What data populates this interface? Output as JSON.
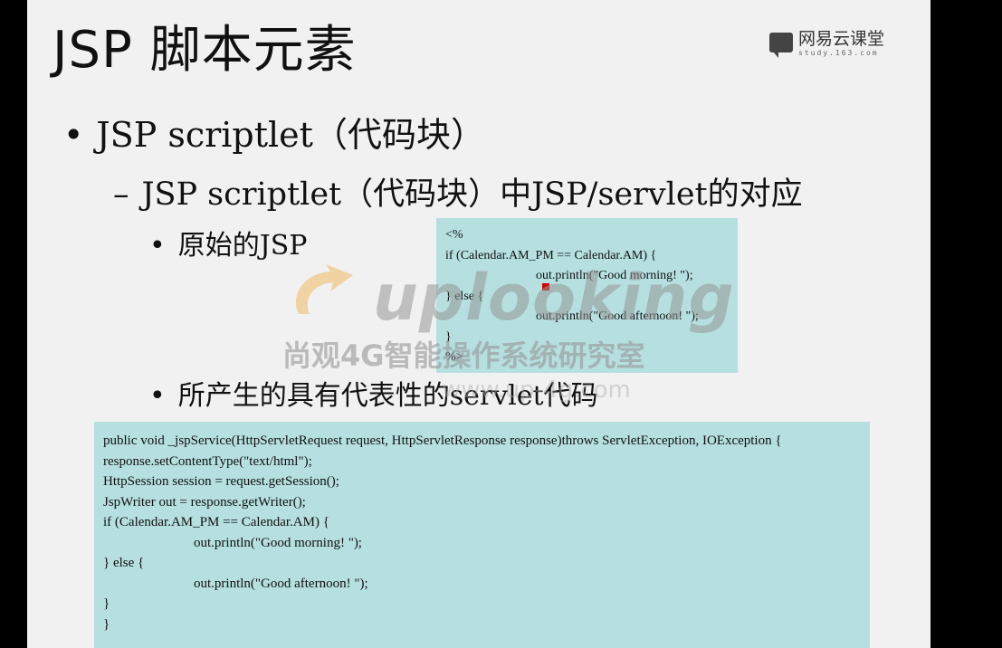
{
  "slide": {
    "title": "JSP 脚本元素",
    "logo_name": "网易云课堂",
    "logo_url": "study.163.com",
    "bullet1": "JSP scriptlet（代码块）",
    "bullet2": "JSP scriptlet（代码块）中JSP/servlet的对应",
    "bullet3a": "原始的JSP",
    "bullet3b": "所产生的具有代表性的servlet代码",
    "bullet_marker": "•",
    "dash_marker": "–"
  },
  "code_original": [
    "<%",
    "if (Calendar.AM_PM == Calendar.AM) {",
    "out.println(\"Good morning! \");",
    "} else {",
    "out.println(\"Good afternoon! \");",
    "}",
    "%>"
  ],
  "code_servlet": [
    "public void _jspService(HttpServletRequest request, HttpServletResponse response)throws ServletException, IOException {",
    "response.setContentType(\"text/html\");",
    "HttpSession session = request.getSession();",
    "JspWriter out = response.getWriter();",
    "if (Calendar.AM_PM == Calendar.AM) {",
    "out.println(\"Good morning! \");",
    "} else {",
    "out.println(\"Good afternoon! \");",
    "}",
    "}"
  ],
  "watermark": {
    "brand": "uplooking",
    "subtitle": "尚观4G智能操作系统研究室",
    "url": "www.up-4g.com"
  },
  "colors": {
    "slide_bg": "#f1f1f1",
    "code_bg": "#b6dfe0",
    "frame": "#000000",
    "watermark_accent": "#f0b860"
  }
}
